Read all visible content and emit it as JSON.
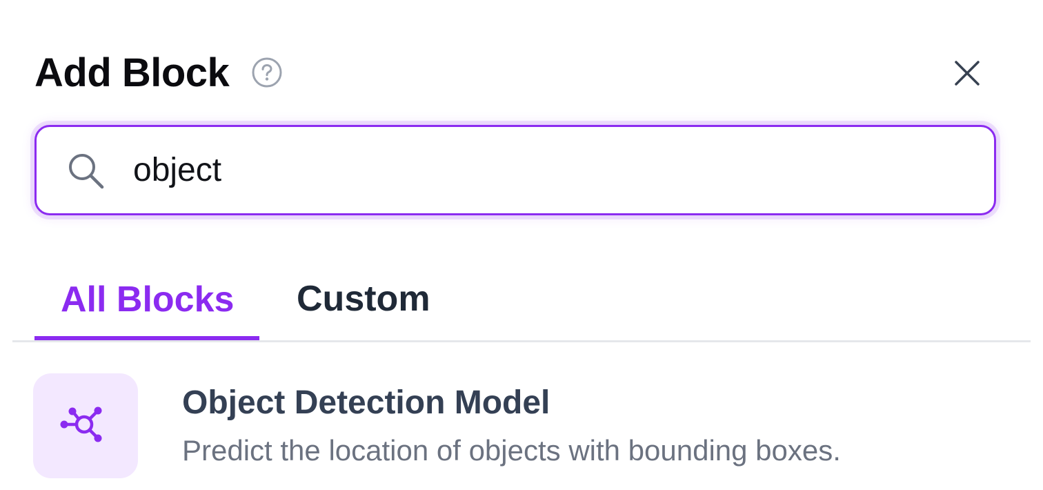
{
  "header": {
    "title": "Add Block",
    "help_icon": "question-circle-icon",
    "close_icon": "close-icon"
  },
  "search": {
    "value": "object",
    "icon": "search-icon"
  },
  "tabs": [
    {
      "label": "All Blocks",
      "active": true
    },
    {
      "label": "Custom",
      "active": false
    }
  ],
  "results": [
    {
      "title": "Object Detection Model",
      "description": "Predict the location of objects with bounding boxes.",
      "icon": "network-nodes-icon"
    }
  ],
  "colors": {
    "accent": "#8b2bf0",
    "accent_light": "#f3e8ff",
    "title_text": "#0b0b0f",
    "body_text": "#344054",
    "muted_text": "#6b7280",
    "divider": "#e5e7eb"
  }
}
